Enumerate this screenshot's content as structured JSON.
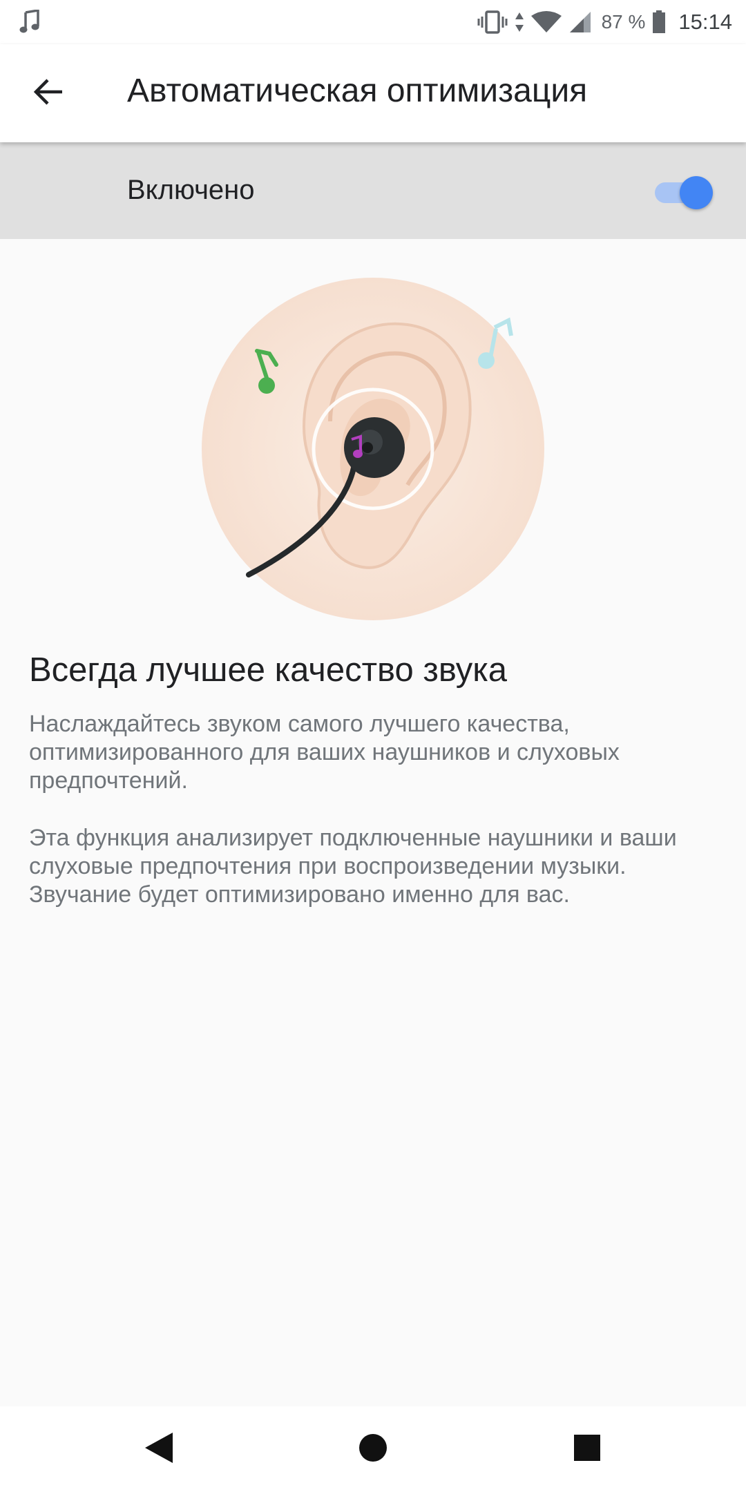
{
  "status_bar": {
    "notification_icon": "music-note-icon",
    "battery_percent": "87 %",
    "time": "15:14",
    "icons": [
      "vibrate-icon",
      "data-arrows-icon",
      "wifi-icon",
      "signal-icon",
      "battery-icon"
    ]
  },
  "app_bar": {
    "back_icon": "arrow-back-icon",
    "title": "Автоматическая оптимизация"
  },
  "master_switch": {
    "label": "Включено",
    "checked": true,
    "accent_color": "#4285f4"
  },
  "content": {
    "heading": "Всегда лучшее качество звука",
    "paragraph_1": "Наслаждайтесь звуком самого лучшего качества, оптимизированного для ваших наушников и слуховых предпочтений.",
    "paragraph_2": "Эта функция анализирует подключенные наушники и ваши слуховые предпочтения при воспроизведении музыки. Звучание будет оптимизировано именно для вас."
  },
  "nav_bar": {
    "buttons": [
      "nav-back-icon",
      "nav-home-icon",
      "nav-recents-icon"
    ]
  }
}
